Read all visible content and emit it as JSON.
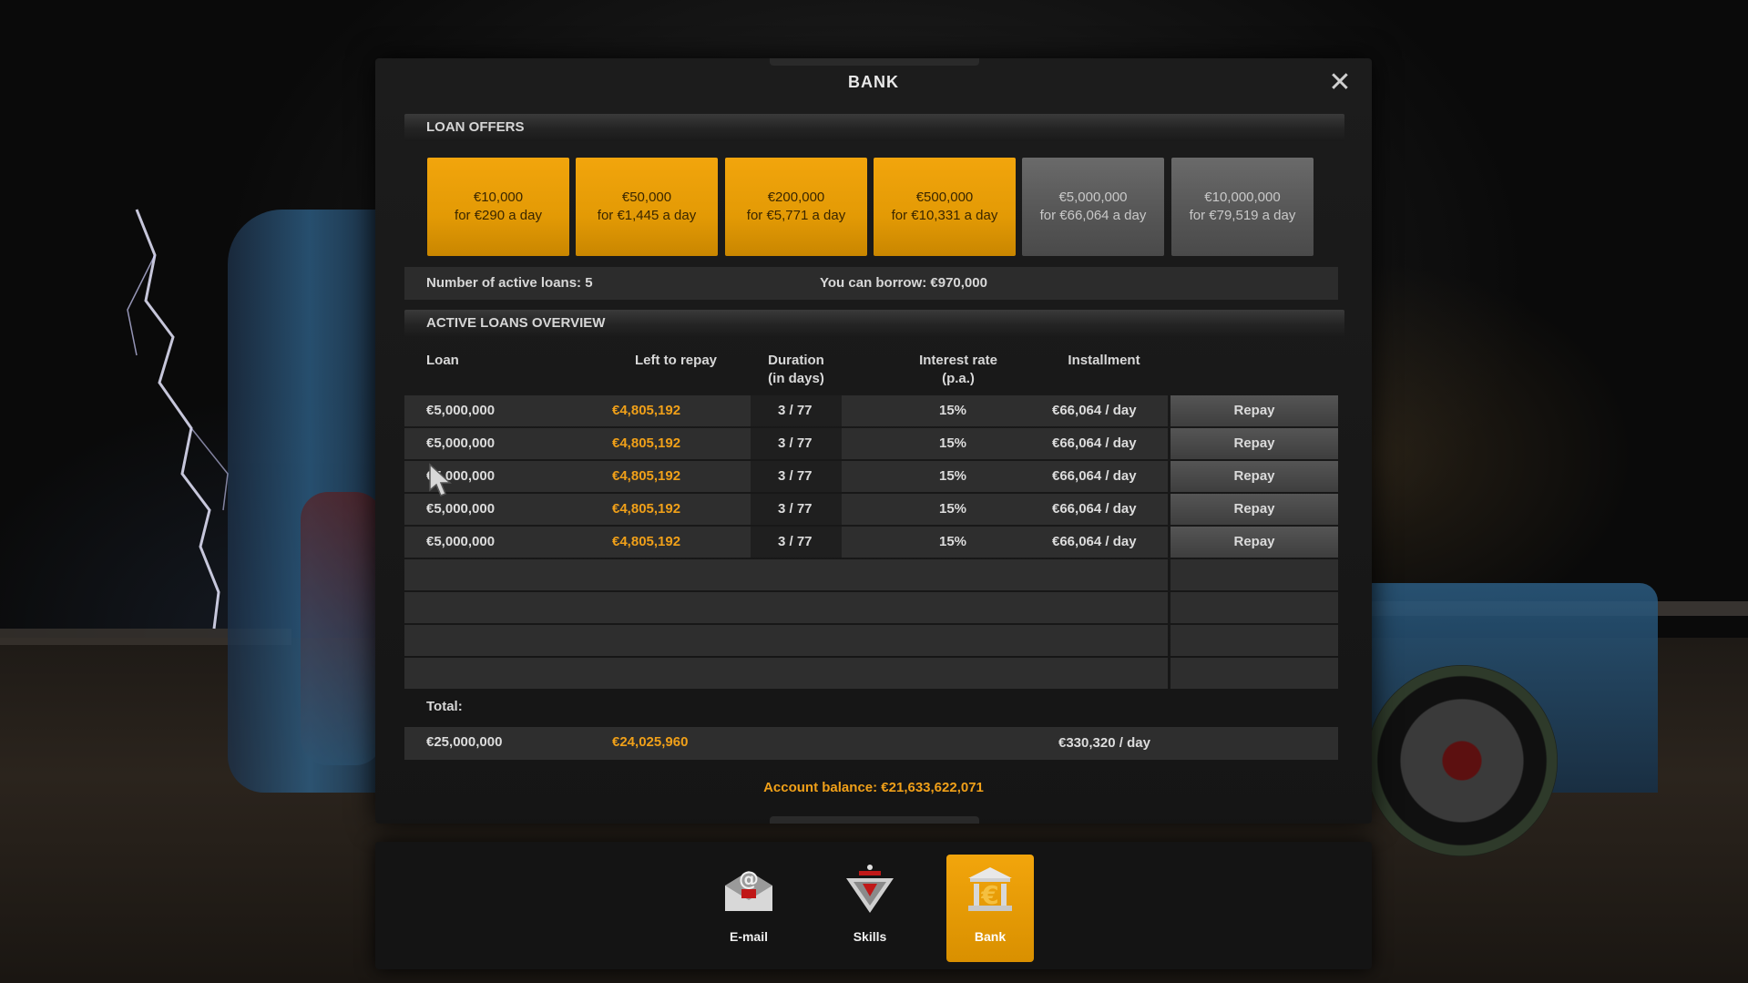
{
  "window": {
    "title": "BANK",
    "close_icon": "close-icon"
  },
  "loan_offers": {
    "header": "LOAN OFFERS",
    "items": [
      {
        "amount": "€10,000",
        "rate": "for €290 a day",
        "available": true
      },
      {
        "amount": "€50,000",
        "rate": "for €1,445 a day",
        "available": true
      },
      {
        "amount": "€200,000",
        "rate": "for €5,771 a day",
        "available": true
      },
      {
        "amount": "€500,000",
        "rate": "for €10,331 a day",
        "available": true
      },
      {
        "amount": "€5,000,000",
        "rate": "for €66,064 a day",
        "available": false
      },
      {
        "amount": "€10,000,000",
        "rate": "for €79,519 a day",
        "available": false
      }
    ]
  },
  "info": {
    "active_loans": "Number of active loans: 5",
    "can_borrow": "You can borrow: €970,000"
  },
  "active_loans": {
    "header": "ACTIVE LOANS OVERVIEW",
    "columns": {
      "loan": "Loan",
      "left": "Left to repay",
      "duration_1": "Duration",
      "duration_2": "(in days)",
      "interest_1": "Interest rate",
      "interest_2": "(p.a.)",
      "installment": "Installment"
    },
    "rows": [
      {
        "loan": "€5,000,000",
        "left": "€4,805,192",
        "duration": "3 / 77",
        "interest": "15%",
        "installment": "€66,064 / day",
        "action": "Repay"
      },
      {
        "loan": "€5,000,000",
        "left": "€4,805,192",
        "duration": "3 / 77",
        "interest": "15%",
        "installment": "€66,064 / day",
        "action": "Repay"
      },
      {
        "loan": "€5,000,000",
        "left": "€4,805,192",
        "duration": "3 / 77",
        "interest": "15%",
        "installment": "€66,064 / day",
        "action": "Repay"
      },
      {
        "loan": "€5,000,000",
        "left": "€4,805,192",
        "duration": "3 / 77",
        "interest": "15%",
        "installment": "€66,064 / day",
        "action": "Repay"
      },
      {
        "loan": "€5,000,000",
        "left": "€4,805,192",
        "duration": "3 / 77",
        "interest": "15%",
        "installment": "€66,064 / day",
        "action": "Repay"
      }
    ],
    "empty_slots": 4
  },
  "total": {
    "label": "Total:",
    "loan": "€25,000,000",
    "left": "€24,025,960",
    "installment": "€330,320 / day"
  },
  "balance": "Account balance: €21,633,622,071",
  "dock": [
    {
      "label": "E-mail",
      "icon": "email-icon",
      "active": false
    },
    {
      "label": "Skills",
      "icon": "skills-icon",
      "active": false
    },
    {
      "label": "Bank",
      "icon": "bank-icon",
      "active": true
    }
  ],
  "colors": {
    "accent": "#f0a019",
    "offer_active": "#e39a05",
    "offer_inactive": "#555555"
  }
}
